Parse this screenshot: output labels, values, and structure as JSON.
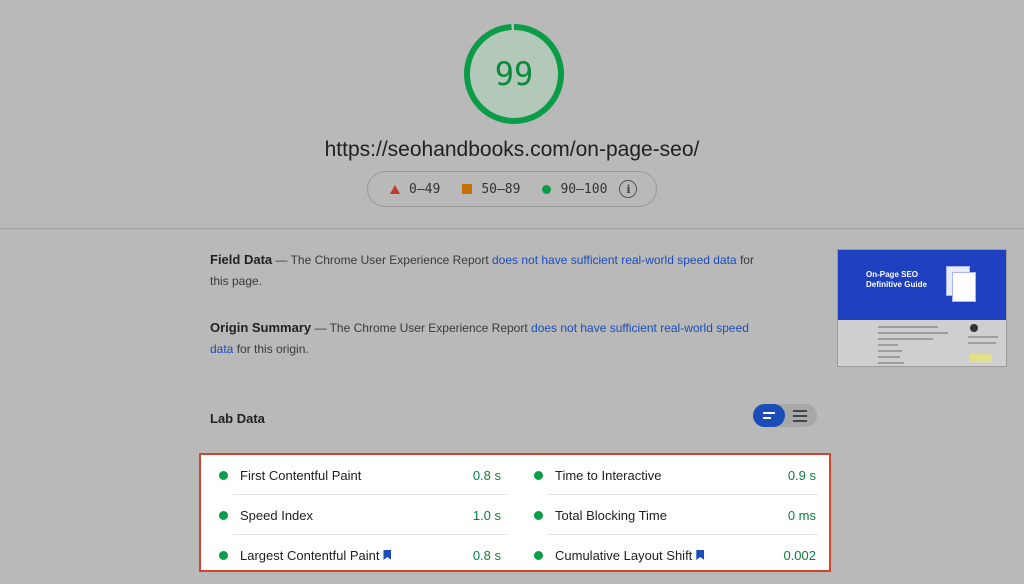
{
  "score": {
    "value": "99",
    "color": "#0b9c48"
  },
  "url": "https://seohandbooks.com/on-page-seo/",
  "legend": [
    {
      "icon": "triangle-fail-icon",
      "label": "0–49"
    },
    {
      "icon": "square-average-icon",
      "label": "50–89"
    },
    {
      "icon": "circle-pass-icon",
      "label": "90–100"
    }
  ],
  "field_data": {
    "title": "Field Data",
    "pre": " — The Chrome User Experience Report ",
    "link": "does not have sufficient real-world speed data",
    "post": " for this page."
  },
  "origin_summary": {
    "title": "Origin Summary",
    "pre": " — The Chrome User Experience Report ",
    "link": "does not have sufficient real-world speed data",
    "post": " for this origin."
  },
  "thumbnail": {
    "hero_title": "On-Page SEO Definitive Guide"
  },
  "lab_data": {
    "title": "Lab Data"
  },
  "metrics": [
    {
      "label": "First Contentful Paint",
      "value": "0.8 s",
      "bookmark": false
    },
    {
      "label": "Time to Interactive",
      "value": "0.9 s",
      "bookmark": false
    },
    {
      "label": "Speed Index",
      "value": "1.0 s",
      "bookmark": false
    },
    {
      "label": "Total Blocking Time",
      "value": "0 ms",
      "bookmark": false
    },
    {
      "label": "Largest Contentful Paint",
      "value": "0.8 s",
      "bookmark": true
    },
    {
      "label": "Cumulative Layout Shift",
      "value": "0.002",
      "bookmark": true
    }
  ]
}
